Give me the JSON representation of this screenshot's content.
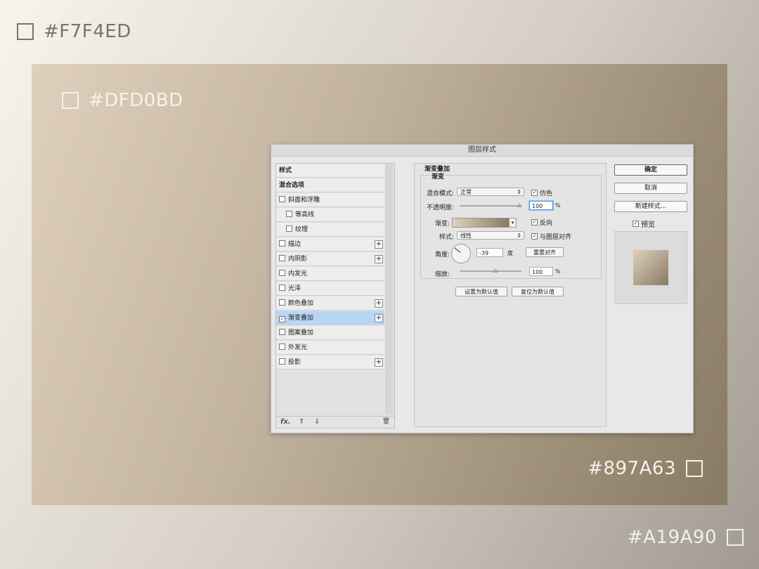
{
  "colors": {
    "c1": "#F7F4ED",
    "c2": "#DFD0BD",
    "c3": "#897A63",
    "c4": "#A19A90"
  },
  "labels": {
    "top_outer": "#F7F4ED",
    "panel_top": "#DFD0BD",
    "panel_bottom": "#897A63",
    "bottom_outer": "#A19A90"
  },
  "dialog": {
    "title": "图层样式",
    "left_list": [
      {
        "label": "样式",
        "type": "header"
      },
      {
        "label": "混合选项",
        "type": "header"
      },
      {
        "label": "斜面和浮雕",
        "checked": false,
        "plus": false,
        "indent": false
      },
      {
        "label": "等高线",
        "checked": false,
        "plus": false,
        "indent": true
      },
      {
        "label": "纹理",
        "checked": false,
        "plus": false,
        "indent": true
      },
      {
        "label": "描边",
        "checked": false,
        "plus": true,
        "indent": false
      },
      {
        "label": "内阴影",
        "checked": false,
        "plus": true,
        "indent": false
      },
      {
        "label": "内发光",
        "checked": false,
        "plus": false,
        "indent": false
      },
      {
        "label": "光泽",
        "checked": false,
        "plus": false,
        "indent": false
      },
      {
        "label": "颜色叠加",
        "checked": false,
        "plus": true,
        "indent": false
      },
      {
        "label": "渐变叠加",
        "checked": true,
        "plus": true,
        "indent": false,
        "selected": true
      },
      {
        "label": "图案叠加",
        "checked": false,
        "plus": false,
        "indent": false
      },
      {
        "label": "外发光",
        "checked": false,
        "plus": false,
        "indent": false
      },
      {
        "label": "投影",
        "checked": false,
        "plus": true,
        "indent": false
      }
    ],
    "list_footer": {
      "fx": "fx.",
      "up": "⇑",
      "down": "⇓",
      "trash": "🗑"
    },
    "section": {
      "title": "渐变叠加",
      "subtitle": "渐变",
      "blend_mode_label": "混合模式:",
      "blend_mode_value": "正常",
      "dither_label": "仿色",
      "dither_checked": true,
      "opacity_label": "不透明度:",
      "opacity_value": "100",
      "opacity_unit": "%",
      "gradient_label": "渐变:",
      "reverse_label": "反向",
      "reverse_checked": true,
      "style_label": "样式:",
      "style_value": "线性",
      "align_label": "与图层对齐",
      "align_checked": true,
      "angle_label": "角度:",
      "angle_value": "-39",
      "angle_unit": "度",
      "reset_align_button": "重置对齐",
      "scale_label": "缩放:",
      "scale_value": "100",
      "scale_unit": "%",
      "make_default_button": "设置为默认值",
      "reset_default_button": "复位为默认值"
    },
    "right": {
      "ok_button": "确定",
      "cancel_button": "取消",
      "new_style_button": "新建样式...",
      "preview_label": "预览",
      "preview_checked": true
    }
  }
}
